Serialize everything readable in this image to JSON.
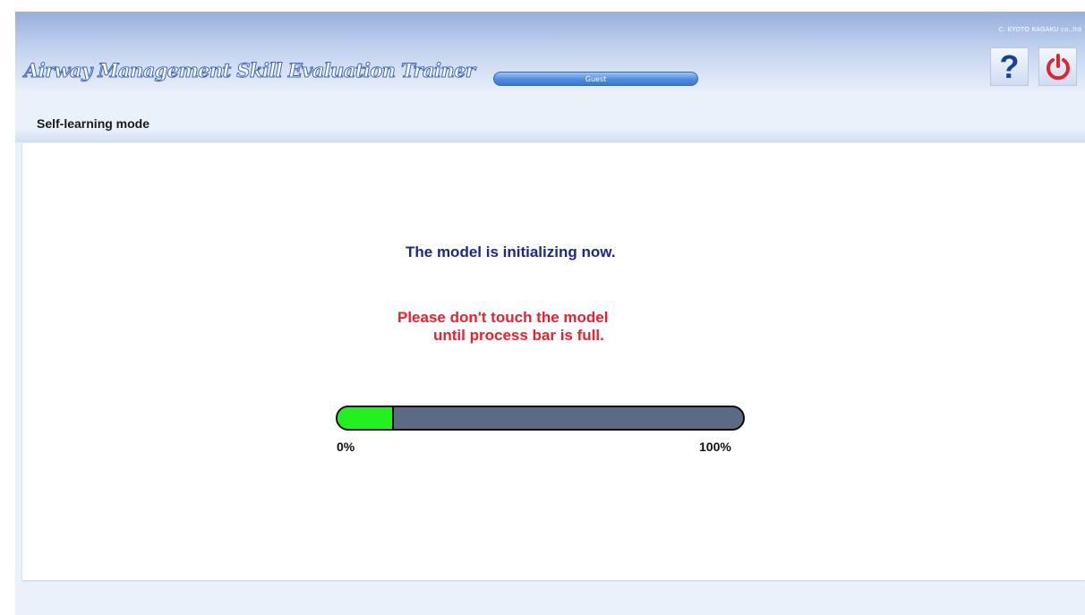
{
  "header": {
    "copyright": "C: KYOTO KAGAKU co.,ltd",
    "app_title": "Airway Management Skill Evaluation Trainer",
    "user_label": "Guest",
    "help_icon": "question-mark-icon",
    "power_icon": "power-icon",
    "help_glyph": "?"
  },
  "mode": {
    "title": "Self-learning mode"
  },
  "main": {
    "status_message": "The model is initializing now.",
    "warning_line1": "Please don't touch the model",
    "warning_line2": "until process bar is full.",
    "progress": {
      "value_percent": 14,
      "min_label": "0%",
      "max_label": "100%"
    }
  },
  "colors": {
    "header_gradient_top": "#97aedc",
    "background": "#e9f1fb",
    "status_text": "#1c2a86",
    "warning_text": "#f01e2c",
    "progress_fill": "#23f020",
    "progress_track": "#5b6b84",
    "power_icon": "#e0262c",
    "help_icon": "#1a3d9e"
  }
}
